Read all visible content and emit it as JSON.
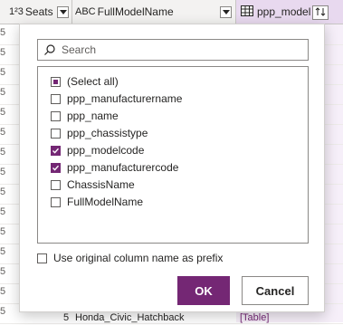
{
  "grid": {
    "columns": [
      {
        "type_icon": "1²3",
        "label": "Seats"
      },
      {
        "type_icon": "ABC",
        "label": "FullModelName"
      },
      {
        "type_icon": "table-icon",
        "label": "ppp_model"
      }
    ],
    "row_first_values": [
      "5",
      "5",
      "5",
      "5",
      "5",
      "5",
      "5",
      "5",
      "5",
      "5",
      "5",
      "5",
      "5",
      "5",
      "5"
    ],
    "last_row": {
      "seats": "5",
      "fullmodelname": "Honda_Civic_Hatchback",
      "ppp_model": "[Table]"
    }
  },
  "expand_popup": {
    "search": {
      "placeholder": "Search",
      "value": ""
    },
    "items": [
      {
        "label": "(Select all)",
        "state": "partial"
      },
      {
        "label": "ppp_manufacturername",
        "state": "unchecked"
      },
      {
        "label": "ppp_name",
        "state": "unchecked"
      },
      {
        "label": "ppp_chassistype",
        "state": "unchecked"
      },
      {
        "label": "ppp_modelcode",
        "state": "checked"
      },
      {
        "label": "ppp_manufacturercode",
        "state": "checked"
      },
      {
        "label": "ChassisName",
        "state": "unchecked"
      },
      {
        "label": "FullModelName",
        "state": "unchecked"
      }
    ],
    "prefix": {
      "label": "Use original column name as prefix",
      "checked": false
    },
    "ok_label": "OK",
    "cancel_label": "Cancel"
  },
  "colors": {
    "accent": "#742774",
    "column_selected": "#e8d9ef"
  }
}
